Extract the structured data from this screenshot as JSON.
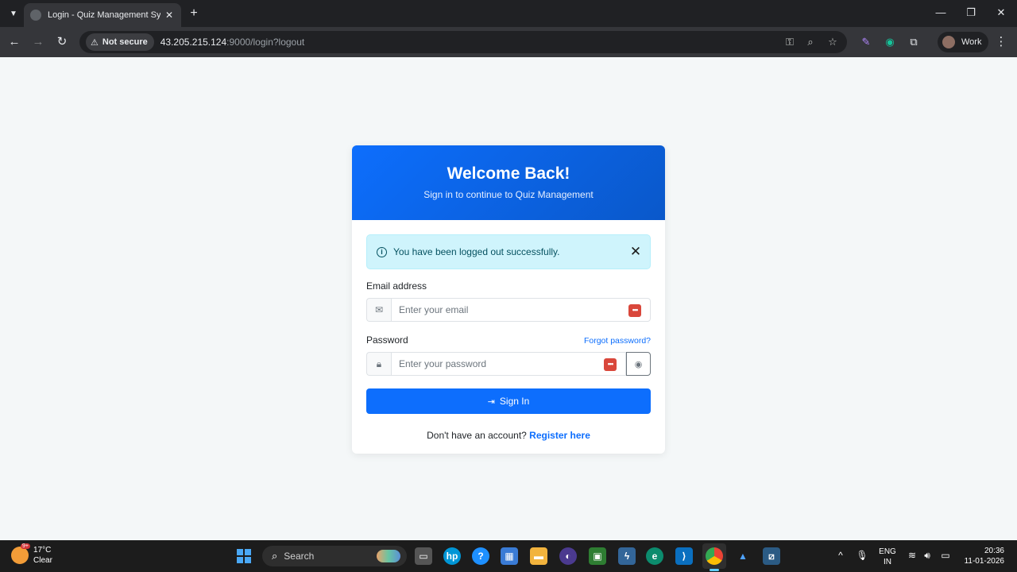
{
  "browser": {
    "tab_title": "Login - Quiz Management System",
    "new_tab": "+",
    "security_label": "Not secure",
    "url_host": "43.205.215.124",
    "url_path": ":9000/login?logout",
    "profile_name": "Work"
  },
  "login": {
    "title": "Welcome Back!",
    "subtitle": "Sign in to continue to Quiz Management",
    "alert_text": "You have been logged out successfully.",
    "email_label": "Email address",
    "email_placeholder": "Enter your email",
    "password_label": "Password",
    "forgot_link": "Forgot password?",
    "password_placeholder": "Enter your password",
    "signin_label": "Sign In",
    "register_prompt": "Don't have an account?",
    "register_link": "Register here",
    "colors": {
      "primary": "#0d6efd",
      "alert_bg": "#cff4fc",
      "alert_text": "#055160"
    }
  },
  "taskbar": {
    "weather_badge": "9+",
    "temperature": "17°C",
    "condition": "Clear",
    "search_label": "Search",
    "lang_top": "ENG",
    "lang_bottom": "IN",
    "time": "20:36",
    "date": "11-01-2026"
  }
}
